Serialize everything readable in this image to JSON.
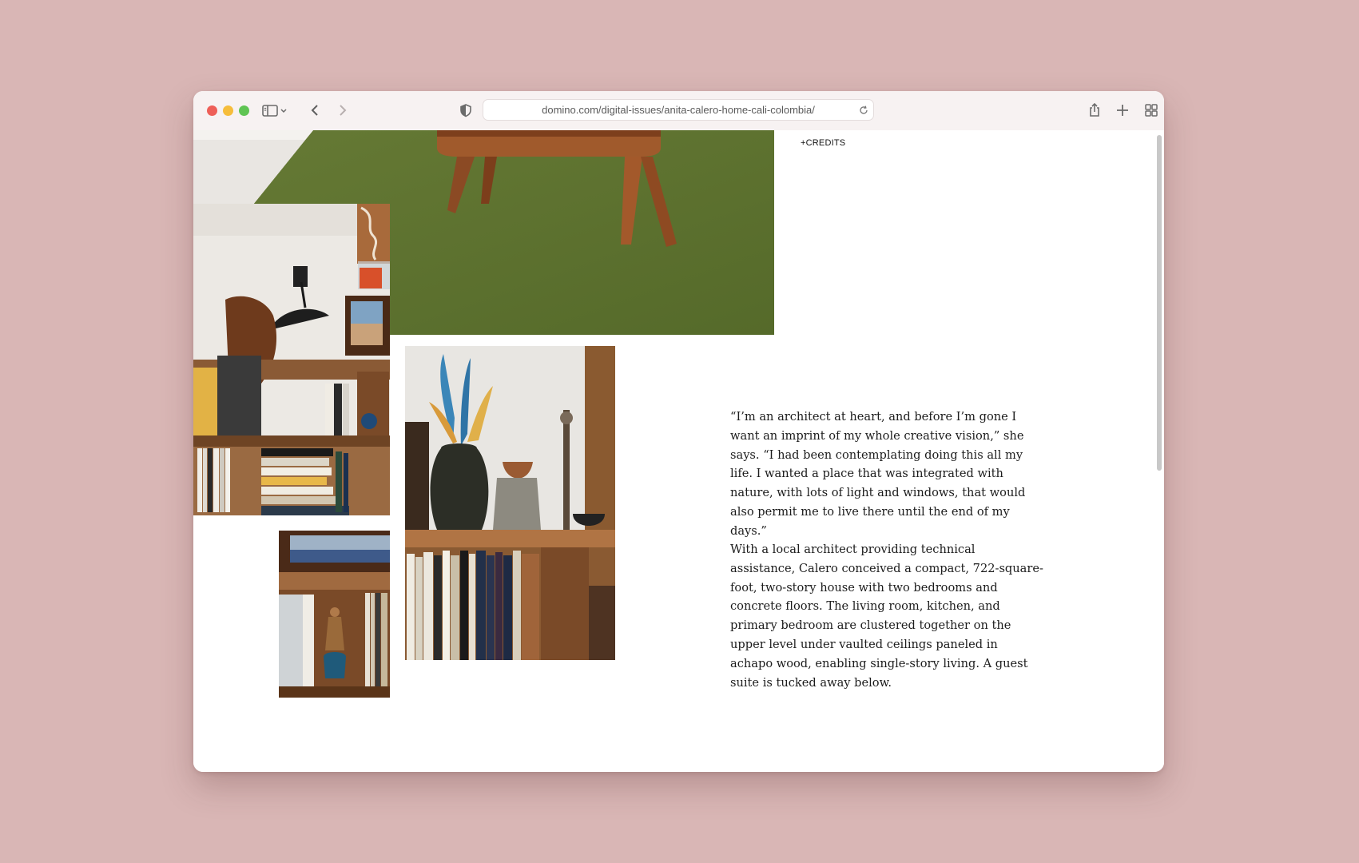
{
  "browser": {
    "url": "domino.com/digital-issues/anita-calero-home-cali-colombia/"
  },
  "icons": {
    "sidebar": "sidebar-icon",
    "chevron": "chevron-down-icon",
    "back": "back-icon",
    "forward": "forward-icon",
    "shield": "privacy-shield-icon",
    "reload": "reload-icon",
    "share": "share-icon",
    "new_tab": "plus-icon",
    "tabs": "tab-overview-icon"
  },
  "article": {
    "credits_label": "+CREDITS",
    "paragraphs": [
      "“I’m an architect at heart, and before I’m gone I want an imprint of my whole creative vision,” she says. “I had been contemplating doing this all my life. I wanted a place that was integrated with nature, with lots of light and windows, that would also permit me to live there until the end of my days.”",
      "With a local architect providing technical assistance, Calero conceived a compact, 722-square-foot, two-story house with two bedrooms and concrete floors. The living room, kitchen, and primary bedroom are clustered together on the upper level under vaulted ceilings paneled in achapo wood, enabling single-story living. A guest suite is tucked away below."
    ]
  },
  "colors": {
    "page_background": "#d9b6b5",
    "rug_green": "#5f7030",
    "wood": "#8a4a25"
  }
}
